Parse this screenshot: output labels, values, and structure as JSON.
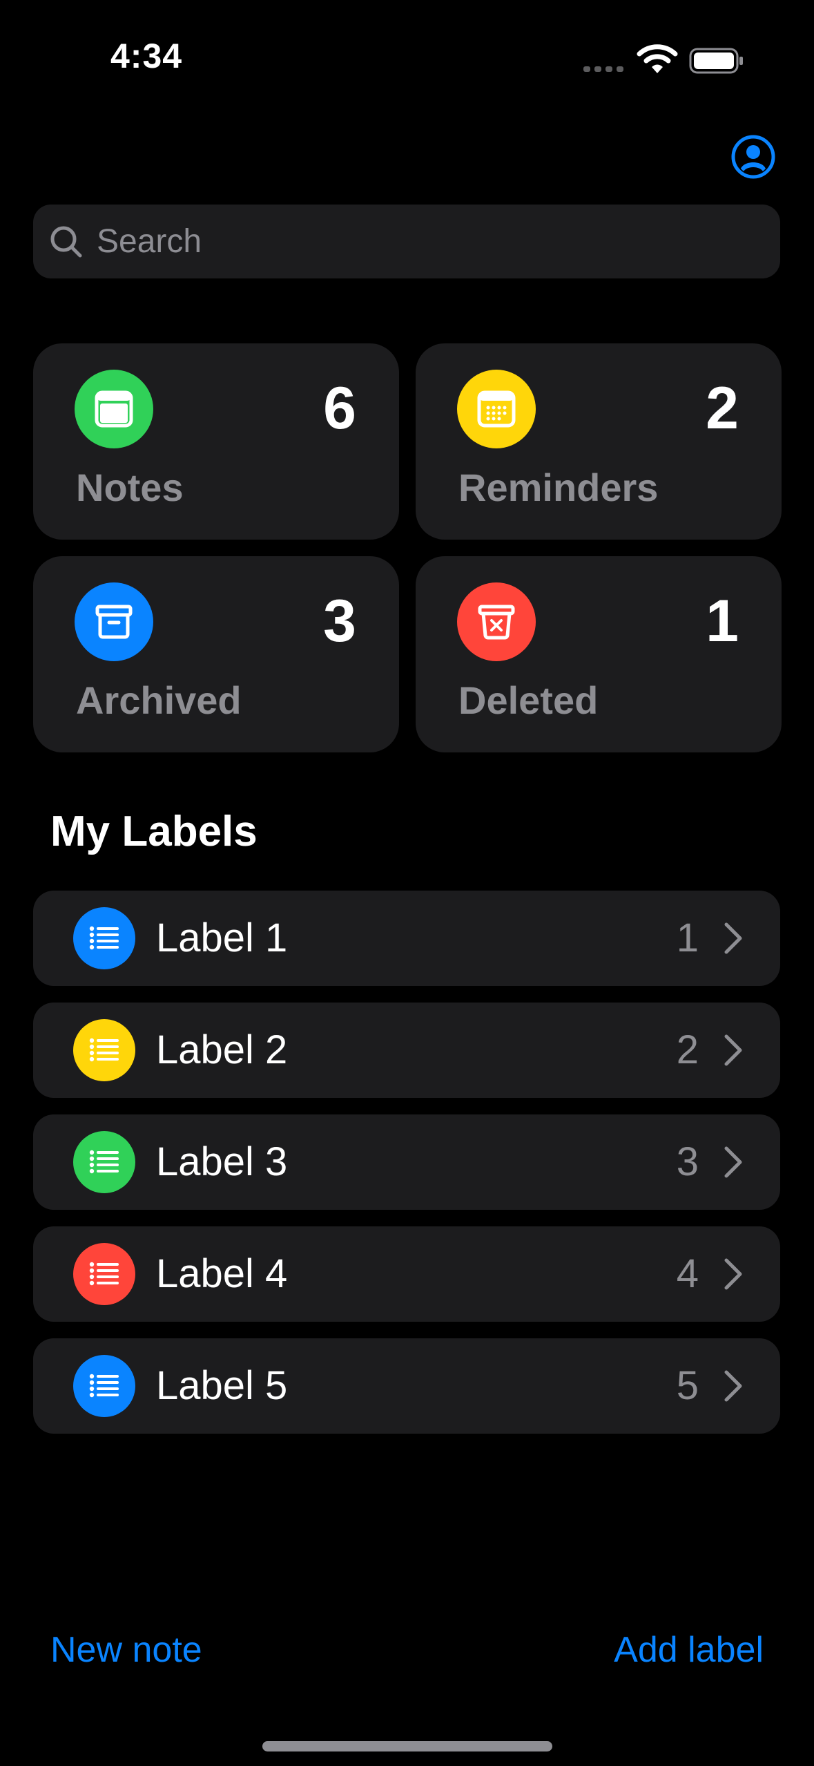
{
  "status_bar": {
    "time": "4:34"
  },
  "search": {
    "placeholder": "Search"
  },
  "cards": [
    {
      "key": "notes",
      "label": "Notes",
      "count": "6",
      "color": "#30d158",
      "icon": "note-icon"
    },
    {
      "key": "reminders",
      "label": "Reminders",
      "count": "2",
      "color": "#ffd60a",
      "icon": "calendar-icon"
    },
    {
      "key": "archived",
      "label": "Archived",
      "count": "3",
      "color": "#0a84ff",
      "icon": "archive-box-icon"
    },
    {
      "key": "deleted",
      "label": "Deleted",
      "count": "1",
      "color": "#ff453a",
      "icon": "trash-icon"
    }
  ],
  "labels_section": {
    "title": "My Labels"
  },
  "labels": [
    {
      "name": "Label 1",
      "count": "1",
      "color": "#0a84ff",
      "icon": "list-icon"
    },
    {
      "name": "Label 2",
      "count": "2",
      "color": "#ffd60a",
      "icon": "list-icon"
    },
    {
      "name": "Label 3",
      "count": "3",
      "color": "#30d158",
      "icon": "list-icon"
    },
    {
      "name": "Label 4",
      "count": "4",
      "color": "#ff453a",
      "icon": "list-icon"
    },
    {
      "name": "Label 5",
      "count": "5",
      "color": "#0a84ff",
      "icon": "list-icon"
    }
  ],
  "toolbar": {
    "new_note": "New note",
    "add_label": "Add label"
  },
  "colors": {
    "accent": "#0a84ff",
    "background": "#000000",
    "surface": "#1c1c1e"
  }
}
